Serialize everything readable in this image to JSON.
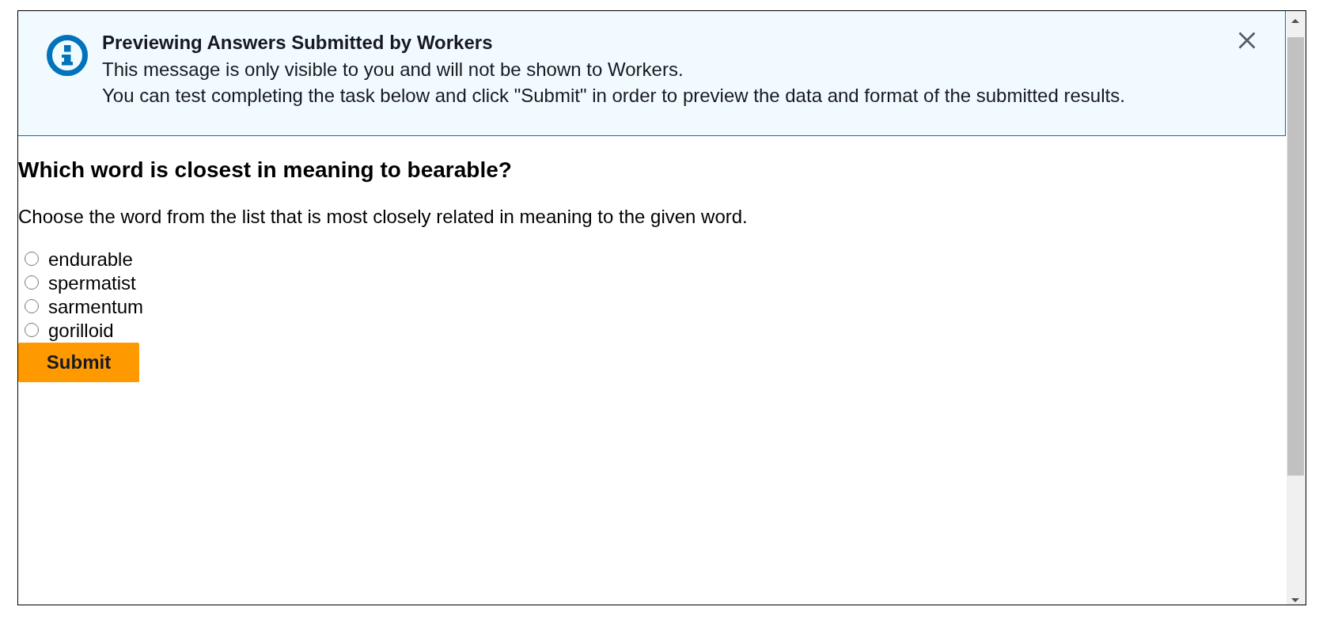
{
  "banner": {
    "title": "Previewing Answers Submitted by Workers",
    "messages": [
      "This message is only visible to you and will not be shown to Workers.",
      "You can test completing the task below and click \"Submit\" in order to preview the data and format of the submitted results."
    ]
  },
  "question": {
    "heading": "Which word is closest in meaning to bearable?",
    "instructions": "Choose the word from the list that is most closely related in meaning to the given word.",
    "options": [
      {
        "label": "endurable",
        "selected": false
      },
      {
        "label": "spermatist",
        "selected": false
      },
      {
        "label": "sarmentum",
        "selected": false
      },
      {
        "label": "gorilloid",
        "selected": false
      }
    ],
    "submit_button": "Submit"
  }
}
